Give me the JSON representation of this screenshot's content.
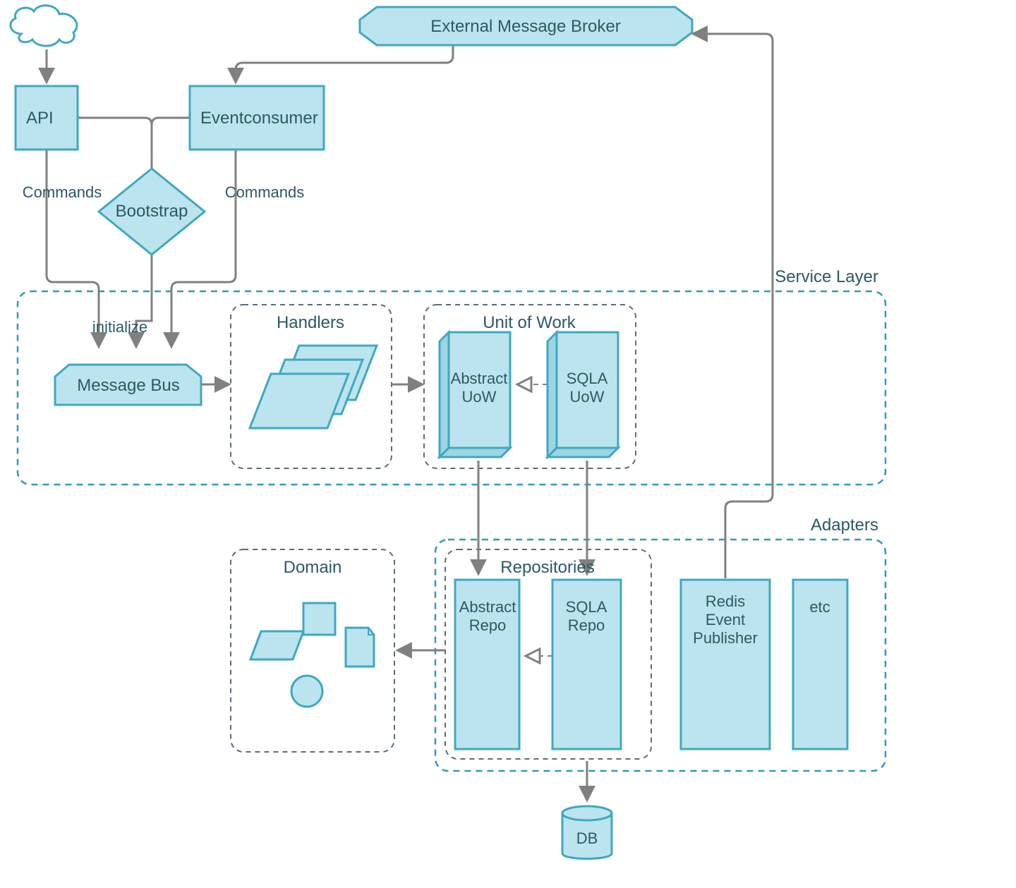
{
  "colors": {
    "fill": "#BCE4EE",
    "stroke": "#3FA8C0",
    "arrow": "#808080",
    "dashedTeal": "#2E9DB5",
    "dashedGray": "#5B6B78",
    "text": "#2d5866"
  },
  "nodes": {
    "cloud": {
      "label": ""
    },
    "api": {
      "label": "API"
    },
    "eventconsumer": {
      "label": "Eventconsumer"
    },
    "broker": {
      "label": "External Message Broker"
    },
    "bootstrap": {
      "label": "Bootstrap"
    },
    "messagebus": {
      "label": "Message Bus"
    },
    "handlers": {
      "label": "Handlers"
    },
    "uow_group": {
      "label": "Unit of Work"
    },
    "abstract_uow": {
      "label1": "Abstract",
      "label2": "UoW"
    },
    "sqla_uow": {
      "label1": "SQLA",
      "label2": "UoW"
    },
    "domain": {
      "label": "Domain"
    },
    "repos_group": {
      "label": "Repositories"
    },
    "abstract_repo": {
      "label1": "Abstract",
      "label2": "Repo"
    },
    "sqla_repo": {
      "label1": "SQLA",
      "label2": "Repo"
    },
    "redis_pub": {
      "label1": "Redis",
      "label2": "Event",
      "label3": "Publisher"
    },
    "etc": {
      "label": "etc"
    },
    "db": {
      "label": "DB"
    }
  },
  "edges": {
    "commands_left": "Commands",
    "commands_right": "Commands",
    "initialize": "initialize"
  },
  "layers": {
    "service": {
      "label": "Service Layer"
    },
    "adapters": {
      "label": "Adapters"
    }
  }
}
